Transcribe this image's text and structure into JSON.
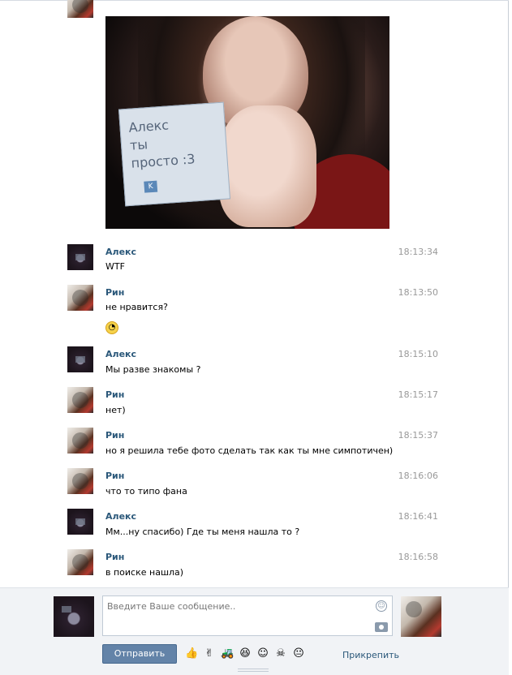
{
  "photo": {
    "card_text": [
      "Алекс",
      "ты",
      "просто :3"
    ],
    "card_logo": "K"
  },
  "messages": [
    {
      "author": "Алекс",
      "time": "18:13:34",
      "text": "WTF",
      "avatar": "alex"
    },
    {
      "author": "Рин",
      "time": "18:13:50",
      "text": "не нравится?",
      "avatar": "rin",
      "emoji": "rolling-eyes-face"
    },
    {
      "author": "Алекс",
      "time": "18:15:10",
      "text": "Мы разве знакомы ?",
      "avatar": "alex"
    },
    {
      "author": "Рин",
      "time": "18:15:17",
      "text": "нет)",
      "avatar": "rin"
    },
    {
      "author": "Рин",
      "time": "18:15:37",
      "text": "но я решила тебе фото сделать так как ты мне симпотичен)",
      "avatar": "rin"
    },
    {
      "author": "Рин",
      "time": "18:16:06",
      "text": "что то типо фана",
      "avatar": "rin"
    },
    {
      "author": "Алекс",
      "time": "18:16:41",
      "text": "Мм...ну спасибо) Где ты меня нашла то ?",
      "avatar": "alex"
    },
    {
      "author": "Рин",
      "time": "18:16:58",
      "text": "в поиске нашла)",
      "avatar": "rin"
    }
  ],
  "composer": {
    "placeholder": "Введите Ваше сообщение..",
    "send_label": "Отправить",
    "attach_label": "Прикрепить",
    "emoji_icons": [
      "thumbs-up-icon",
      "victory-hand-icon",
      "tractor-icon",
      "grinning-face-icon",
      "smiling-face-icon",
      "skull-icon",
      "neutral-face-icon"
    ]
  },
  "colors": {
    "link": "#2b587a",
    "button": "#6383a8",
    "timestamp": "#999999"
  }
}
